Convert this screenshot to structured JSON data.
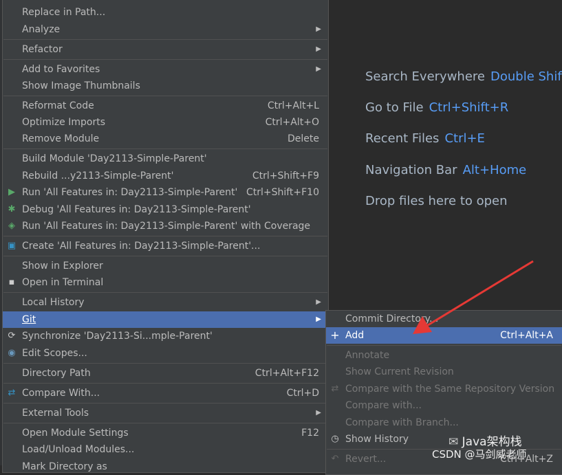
{
  "editor": {
    "hints": [
      {
        "label": "Search Everywhere",
        "key": "Double Shift"
      },
      {
        "label": "Go to File",
        "key": "Ctrl+Shift+R"
      },
      {
        "label": "Recent Files",
        "key": "Ctrl+E"
      },
      {
        "label": "Navigation Bar",
        "key": "Alt+Home"
      },
      {
        "label": "Drop files here to open",
        "key": ""
      }
    ]
  },
  "context_menu": {
    "items": [
      {
        "label": "Replace in Path...",
        "shortcut": ""
      },
      {
        "label": "Analyze",
        "shortcut": ""
      },
      {
        "label": "Refactor",
        "shortcut": ""
      },
      {
        "label": "Add to Favorites",
        "shortcut": ""
      },
      {
        "label": "Show Image Thumbnails",
        "shortcut": ""
      },
      {
        "label": "Reformat Code",
        "shortcut": "Ctrl+Alt+L"
      },
      {
        "label": "Optimize Imports",
        "shortcut": "Ctrl+Alt+O"
      },
      {
        "label": "Remove Module",
        "shortcut": "Delete"
      },
      {
        "label": "Build Module 'Day2113-Simple-Parent'",
        "shortcut": ""
      },
      {
        "label": "Rebuild ...y2113-Simple-Parent'",
        "shortcut": "Ctrl+Shift+F9"
      },
      {
        "label": "Run 'All Features in: Day2113-Simple-Parent'",
        "shortcut": "Ctrl+Shift+F10"
      },
      {
        "label": "Debug 'All Features in: Day2113-Simple-Parent'",
        "shortcut": ""
      },
      {
        "label": "Run 'All Features in: Day2113-Simple-Parent' with Coverage",
        "shortcut": ""
      },
      {
        "label": "Create 'All Features in: Day2113-Simple-Parent'...",
        "shortcut": ""
      },
      {
        "label": "Show in Explorer",
        "shortcut": ""
      },
      {
        "label": "Open in Terminal",
        "shortcut": ""
      },
      {
        "label": "Local History",
        "shortcut": ""
      },
      {
        "label": "Git",
        "shortcut": ""
      },
      {
        "label": "Synchronize 'Day2113-Si...mple-Parent'",
        "shortcut": ""
      },
      {
        "label": "Edit Scopes...",
        "shortcut": ""
      },
      {
        "label": "Directory Path",
        "shortcut": "Ctrl+Alt+F12"
      },
      {
        "label": "Compare With...",
        "shortcut": "Ctrl+D"
      },
      {
        "label": "External Tools",
        "shortcut": ""
      },
      {
        "label": "Open Module Settings",
        "shortcut": "F12"
      },
      {
        "label": "Load/Unload Modules...",
        "shortcut": ""
      },
      {
        "label": "Mark Directory as",
        "shortcut": ""
      }
    ]
  },
  "git_submenu": {
    "items": [
      {
        "label": "Commit Directory...",
        "shortcut": ""
      },
      {
        "label": "Add",
        "shortcut": "Ctrl+Alt+A"
      },
      {
        "label": "Annotate",
        "shortcut": ""
      },
      {
        "label": "Show Current Revision",
        "shortcut": ""
      },
      {
        "label": "Compare with the Same Repository Version",
        "shortcut": ""
      },
      {
        "label": "Compare with...",
        "shortcut": ""
      },
      {
        "label": "Compare with Branch...",
        "shortcut": ""
      },
      {
        "label": "Show History",
        "shortcut": ""
      },
      {
        "label": "Revert...",
        "shortcut": "Ctrl+Alt+Z"
      }
    ]
  },
  "watermark": {
    "wechat": "Java架构栈",
    "csdn": "CSDN @马剑威老师"
  },
  "colors": {
    "menu_bg": "#3c3f41",
    "selection": "#4b6eaf",
    "hint_key": "#589df6",
    "annotation_arrow": "#e53935"
  }
}
